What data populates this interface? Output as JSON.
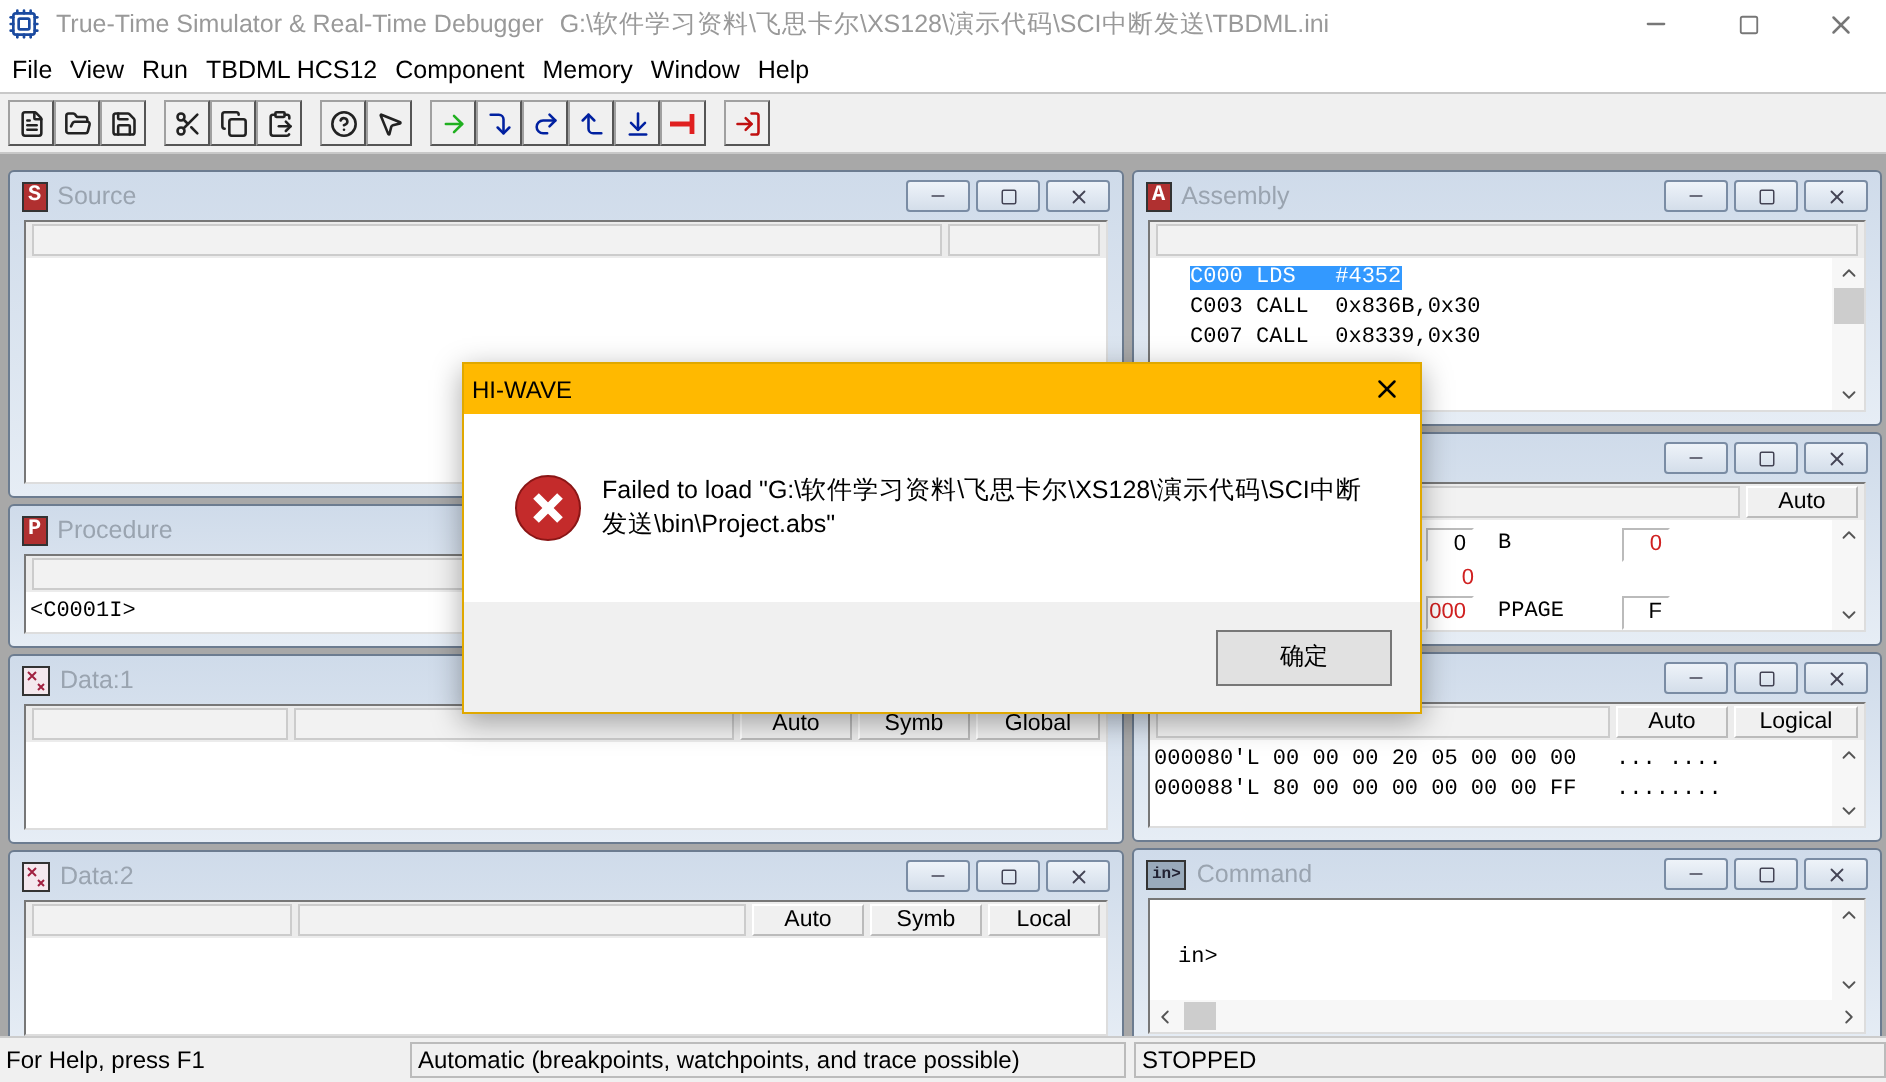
{
  "title_bar": {
    "app_title": "True-Time Simulator & Real-Time Debugger",
    "file_path": "G:\\软件学习资料\\飞思卡尔\\XS128\\演示代码\\SCI中断发送\\TBDML.ini"
  },
  "menu": [
    "File",
    "View",
    "Run",
    "TBDML HCS12",
    "Component",
    "Memory",
    "Window",
    "Help"
  ],
  "left_windows": [
    {
      "kind": "source",
      "icon_text": "S",
      "title": "Source"
    },
    {
      "kind": "procedure",
      "icon_text": "P",
      "title": "Procedure",
      "lines": [
        "<C0001I>"
      ]
    },
    {
      "kind": "data",
      "title": "Data:1",
      "header_buttons": [
        "Auto",
        "Symb",
        "Global"
      ]
    },
    {
      "kind": "data",
      "title": "Data:2",
      "header_buttons": [
        "Auto",
        "Symb",
        "Local"
      ]
    }
  ],
  "right_windows": [
    {
      "kind": "assembly",
      "icon_text": "A",
      "title": "Assembly",
      "lines": [
        {
          "text": "C000 LDS   #4352",
          "selected": true
        },
        {
          "text": "C003 CALL  0x836B,0x30",
          "selected": false
        },
        {
          "text": "C007 CALL  0x8339,0x30",
          "selected": false
        }
      ]
    },
    {
      "kind": "register",
      "header_buttons": [
        "Auto"
      ],
      "rows": [
        [
          {
            "kind": "value",
            "text": "0",
            "changed": false
          },
          {
            "kind": "label",
            "text": "B"
          },
          {
            "kind": "value",
            "text": "0",
            "changed": true
          }
        ],
        [
          {
            "kind": "plain",
            "text": "0",
            "changed": true
          }
        ],
        [
          {
            "kind": "value",
            "text": "000",
            "changed": true
          },
          {
            "kind": "label",
            "text": "PPAGE"
          },
          {
            "kind": "value",
            "text": "F",
            "changed": false
          }
        ]
      ]
    },
    {
      "kind": "memory",
      "header_buttons": [
        "Auto",
        "Logical"
      ],
      "lines": [
        "000080'L 00 00 00 20 05 00 00 00   ... ....",
        "000088'L 80 00 00 00 00 00 00 FF   ........"
      ]
    },
    {
      "kind": "command",
      "icon_text": "in>",
      "title": "Command",
      "lines": [
        "in>"
      ]
    }
  ],
  "status_bar": [
    "For Help, press F1",
    "Automatic (breakpoints, watchpoints, and trace possible)",
    "STOPPED"
  ],
  "dialog": {
    "title": "HI-WAVE",
    "message": "Failed to load \"G:\\软件学习资料\\飞思卡尔\\XS128\\演示代码\\SCI中断发送\\bin\\Project.abs\"",
    "button": "确定"
  }
}
